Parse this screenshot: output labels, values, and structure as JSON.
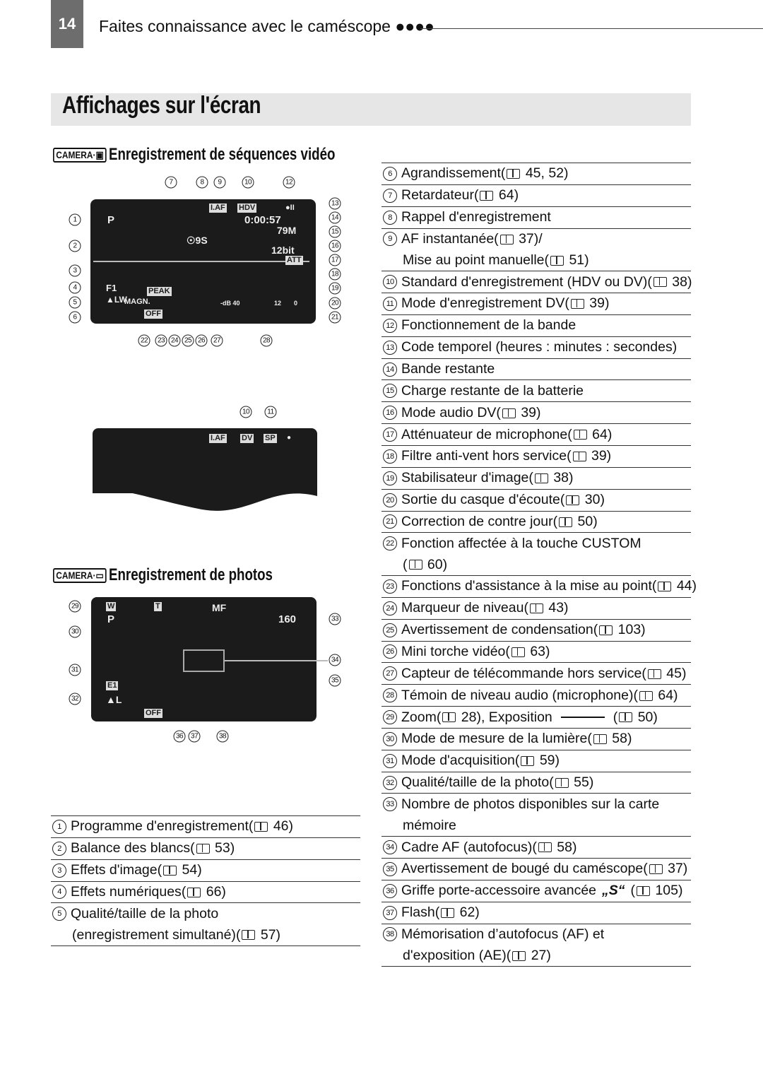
{
  "header": {
    "page_number": "14",
    "running_title": "Faites connaissance avec le caméscope ●●●●"
  },
  "title": "Affichages sur l'écran",
  "sections": {
    "video": {
      "tag": "CAMERA·▣",
      "title": "Enregistrement de séquences vidéo"
    },
    "photo": {
      "tag": "CAMERA·▭",
      "title": "Enregistrement de photos"
    }
  },
  "screen1": {
    "texts": [
      "P",
      "I.AF",
      "HDV",
      "●II",
      "0:00:57",
      "79M",
      "12bit",
      "ATT",
      "☉9S",
      "F1",
      "▲LW",
      "MAGN.",
      "OFF",
      "PEAK",
      "-dB 40",
      "12",
      "0"
    ],
    "callouts": [
      "1",
      "2",
      "3",
      "4",
      "5",
      "6",
      "7",
      "8",
      "9",
      "10",
      "12",
      "13",
      "14",
      "15",
      "16",
      "17",
      "18",
      "19",
      "20",
      "21",
      "22",
      "23",
      "24",
      "25",
      "26",
      "27",
      "28"
    ]
  },
  "screen2": {
    "texts": [
      "I.AF",
      "DV",
      "SP",
      "●"
    ],
    "callouts": [
      "10",
      "11"
    ]
  },
  "screen3": {
    "texts": [
      "W",
      "T",
      "P",
      "MF",
      "160",
      "E1",
      "▲L",
      "OFF"
    ],
    "callouts": [
      "29",
      "30",
      "31",
      "32",
      "33",
      "34",
      "35",
      "36",
      "37",
      "38"
    ]
  },
  "left_list": [
    {
      "n": "1",
      "lines": [
        [
          "Programme d'enregistrement ",
          {
            "ref": "46"
          }
        ]
      ]
    },
    {
      "n": "2",
      "lines": [
        [
          "Balance des blancs ",
          {
            "ref": "53"
          }
        ]
      ]
    },
    {
      "n": "3",
      "lines": [
        [
          "Effets d'image ",
          {
            "ref": "54"
          }
        ]
      ]
    },
    {
      "n": "4",
      "lines": [
        [
          "Effets numériques ",
          {
            "ref": "66"
          }
        ]
      ]
    },
    {
      "n": "5",
      "lines": [
        [
          "Qualité/taille de la photo"
        ],
        [
          "(enregistrement simultané) ",
          {
            "ref": "57"
          }
        ]
      ]
    }
  ],
  "right_list": [
    {
      "n": "6",
      "lines": [
        [
          "Agrandissement ",
          {
            "ref": "45, 52"
          }
        ]
      ]
    },
    {
      "n": "7",
      "lines": [
        [
          "Retardateur ",
          {
            "ref": "64"
          }
        ]
      ]
    },
    {
      "n": "8",
      "lines": [
        [
          "Rappel d'enregistrement"
        ]
      ]
    },
    {
      "n": "9",
      "lines": [
        [
          "AF instantanée ",
          {
            "ref": "37"
          },
          "/"
        ],
        [
          "Mise au point manuelle ",
          {
            "ref": "51"
          }
        ]
      ]
    },
    {
      "n": "10",
      "lines": [
        [
          "Standard d'enregistrement (HDV ou DV) ",
          {
            "ref": "38"
          }
        ]
      ]
    },
    {
      "n": "11",
      "lines": [
        [
          "Mode d'enregistrement DV ",
          {
            "ref": "39"
          }
        ]
      ]
    },
    {
      "n": "12",
      "lines": [
        [
          "Fonctionnement de la bande"
        ]
      ]
    },
    {
      "n": "13",
      "lines": [
        [
          "Code temporel (heures : minutes : secondes)"
        ]
      ]
    },
    {
      "n": "14",
      "lines": [
        [
          "Bande restante"
        ]
      ]
    },
    {
      "n": "15",
      "lines": [
        [
          "Charge restante de la batterie"
        ]
      ]
    },
    {
      "n": "16",
      "lines": [
        [
          "Mode audio DV ",
          {
            "ref": "39"
          }
        ]
      ]
    },
    {
      "n": "17",
      "lines": [
        [
          "Atténuateur de microphone ",
          {
            "ref": "64"
          }
        ]
      ]
    },
    {
      "n": "18",
      "lines": [
        [
          "Filtre anti-vent hors service ",
          {
            "ref": "39"
          }
        ]
      ]
    },
    {
      "n": "19",
      "lines": [
        [
          "Stabilisateur d'image ",
          {
            "ref": "38"
          }
        ]
      ]
    },
    {
      "n": "20",
      "lines": [
        [
          "Sortie du casque d'écoute ",
          {
            "ref": "30"
          }
        ]
      ]
    },
    {
      "n": "21",
      "lines": [
        [
          "Correction de contre jour ",
          {
            "ref": "50"
          }
        ]
      ]
    },
    {
      "n": "22",
      "lines": [
        [
          "Fonction affectée à la touche CUSTOM"
        ],
        [
          {
            "ref": "60"
          }
        ]
      ]
    },
    {
      "n": "23",
      "lines": [
        [
          "Fonctions d'assistance à la mise au point ",
          {
            "ref": "44"
          }
        ]
      ]
    },
    {
      "n": "24",
      "lines": [
        [
          "Marqueur de niveau ",
          {
            "ref": "43"
          }
        ]
      ]
    },
    {
      "n": "25",
      "lines": [
        [
          "Avertissement de condensation ",
          {
            "ref": "103"
          }
        ]
      ]
    },
    {
      "n": "26",
      "lines": [
        [
          "Mini torche vidéo ",
          {
            "ref": "63"
          }
        ]
      ]
    },
    {
      "n": "27",
      "lines": [
        [
          "Capteur de télécommande hors service ",
          {
            "ref": "45"
          }
        ]
      ]
    },
    {
      "n": "28",
      "lines": [
        [
          "Témoin de niveau audio (microphone) ",
          {
            "ref": "64"
          }
        ]
      ]
    },
    {
      "n": "29",
      "lines": [
        [
          "Zoom ",
          {
            "ref": "28"
          },
          ", Exposition",
          {
            "icon": "exposure-slider-icon"
          },
          {
            "ref": "50"
          }
        ]
      ]
    },
    {
      "n": "30",
      "lines": [
        [
          "Mode de mesure de la lumière ",
          {
            "ref": "58"
          }
        ]
      ]
    },
    {
      "n": "31",
      "lines": [
        [
          "Mode d'acquisition ",
          {
            "ref": "59"
          }
        ]
      ]
    },
    {
      "n": "32",
      "lines": [
        [
          "Qualité/taille de la photo ",
          {
            "ref": "55"
          }
        ]
      ]
    },
    {
      "n": "33",
      "lines": [
        [
          "Nombre de photos disponibles sur la carte"
        ],
        [
          "mémoire"
        ]
      ]
    },
    {
      "n": "34",
      "lines": [
        [
          "Cadre AF (autofocus) ",
          {
            "ref": "58"
          }
        ]
      ]
    },
    {
      "n": "35",
      "lines": [
        [
          "Avertissement de bougé du caméscope ",
          {
            "ref": "37"
          }
        ]
      ]
    },
    {
      "n": "36",
      "lines": [
        [
          "Griffe porte-accessoire avancée",
          {
            "icon": "accessory-shoe-icon",
            "glyph": "„S“"
          },
          {
            "ref": "105"
          }
        ]
      ]
    },
    {
      "n": "37",
      "lines": [
        [
          "Flash ",
          {
            "ref": "62"
          }
        ]
      ]
    },
    {
      "n": "38",
      "lines": [
        [
          "Mémorisation d’autofocus (AF) et"
        ],
        [
          "d'exposition (AE) ",
          {
            "ref": "27"
          }
        ]
      ]
    }
  ]
}
